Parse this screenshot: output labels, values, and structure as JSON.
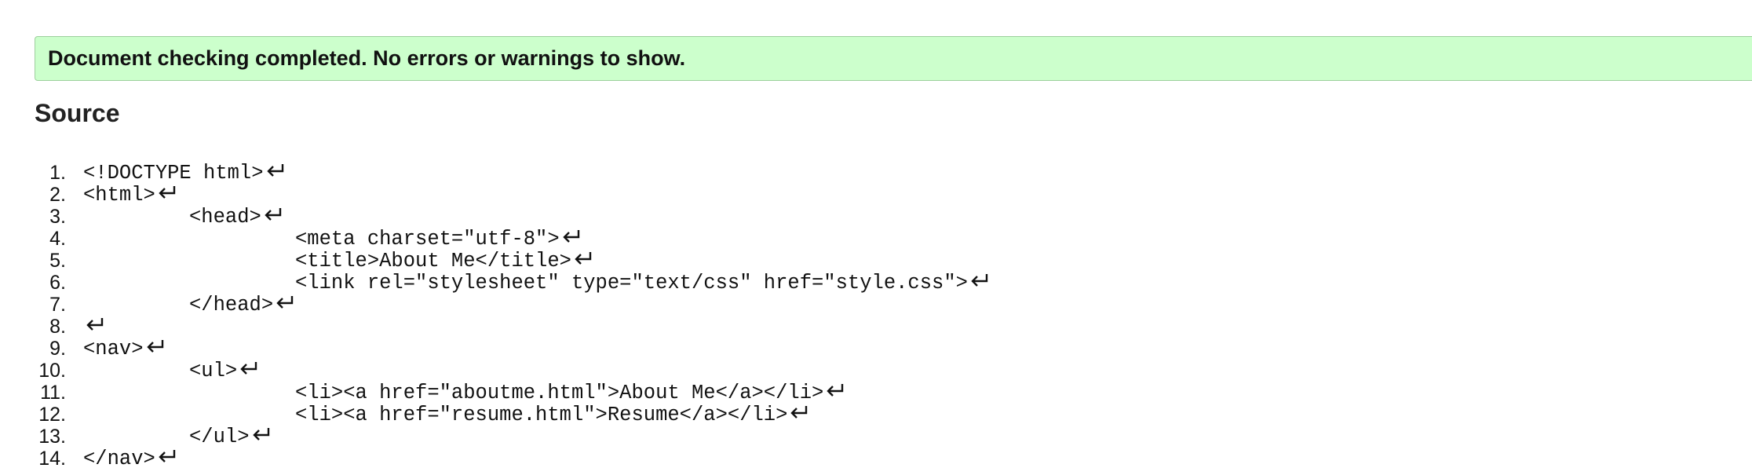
{
  "status": {
    "message": "Document checking completed. No errors or warnings to show."
  },
  "source": {
    "heading": "Source",
    "return_icon": "return-arrow-icon",
    "lines": [
      {
        "number": "1.",
        "indent": 0,
        "code": "<!DOCTYPE html>"
      },
      {
        "number": "2.",
        "indent": 0,
        "code": "<html>"
      },
      {
        "number": "3.",
        "indent": 1,
        "code": "<head>"
      },
      {
        "number": "4.",
        "indent": 2,
        "code": "<meta charset=\"utf-8\">"
      },
      {
        "number": "5.",
        "indent": 2,
        "code": "<title>About Me</title>"
      },
      {
        "number": "6.",
        "indent": 2,
        "code": "<link rel=\"stylesheet\" type=\"text/css\" href=\"style.css\">"
      },
      {
        "number": "7.",
        "indent": 1,
        "code": "</head>"
      },
      {
        "number": "8.",
        "indent": 0,
        "code": ""
      },
      {
        "number": "9.",
        "indent": 0,
        "code": "<nav>"
      },
      {
        "number": "10.",
        "indent": 1,
        "code": "<ul>"
      },
      {
        "number": "11.",
        "indent": 2,
        "code": "<li><a href=\"aboutme.html\">About Me</a></li>"
      },
      {
        "number": "12.",
        "indent": 2,
        "code": "<li><a href=\"resume.html\">Resume</a></li>"
      },
      {
        "number": "13.",
        "indent": 1,
        "code": "</ul>"
      },
      {
        "number": "14.",
        "indent": 0,
        "code": "</nav>"
      }
    ]
  }
}
